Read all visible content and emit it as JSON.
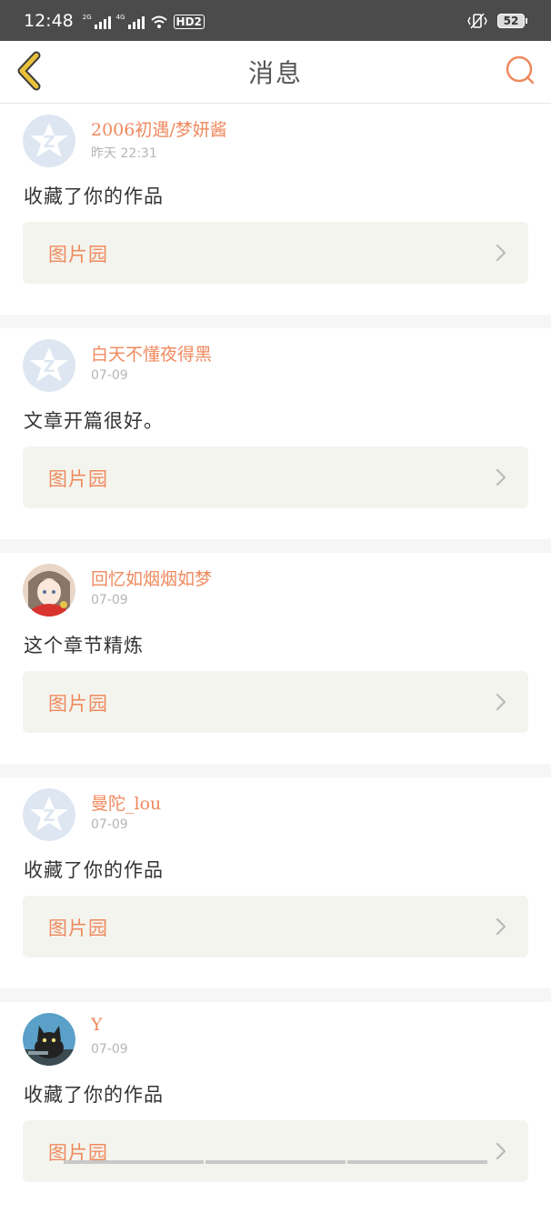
{
  "status_bar": {
    "time": "12:48",
    "signal1_label": "2G",
    "signal2_label": "4G",
    "hd_label": "HD2",
    "battery_level": "52"
  },
  "header": {
    "title": "消息",
    "back_icon": "chevron-left-icon",
    "search_icon": "search-icon"
  },
  "colors": {
    "accent": "#ef8a5e",
    "back_icon": "#e9c13a",
    "card_bg": "#f4f4ee",
    "separator": "#f6f6f6"
  },
  "notifications": [
    {
      "username": "2006初遇/梦妍酱",
      "time": "昨天 22:31",
      "message": "收藏了你的作品",
      "work": "图片园",
      "avatar": "default-avatar"
    },
    {
      "username": "白天不懂夜得黑",
      "time": "07-09",
      "message": "文章开篇很好。",
      "work": "图片园",
      "avatar": "default-avatar"
    },
    {
      "username": "回忆如烟烟如梦",
      "time": "07-09",
      "message": "这个章节精炼",
      "work": "图片园",
      "avatar": "anime-girl-avatar"
    },
    {
      "username": "曼陀_lou",
      "time": "07-09",
      "message": "收藏了你的作品",
      "work": "图片园",
      "avatar": "default-avatar"
    },
    {
      "username": "Y",
      "time": "07-09",
      "message": "收藏了你的作品",
      "work": "图片园",
      "avatar": "black-cat-avatar"
    }
  ]
}
